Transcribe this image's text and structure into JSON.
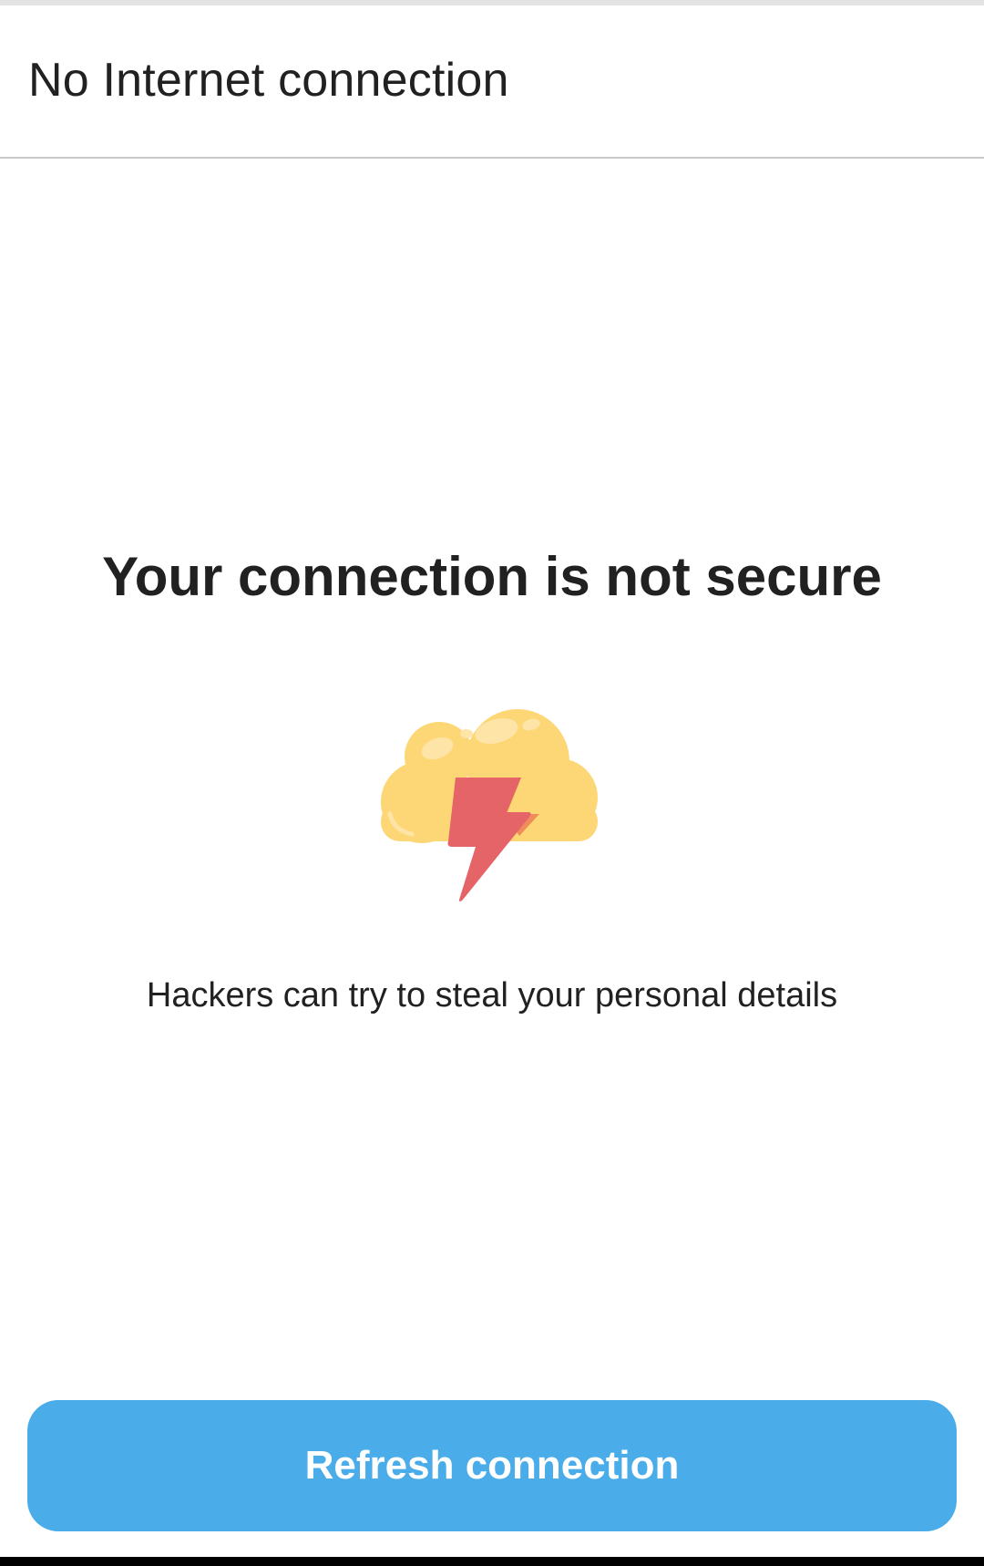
{
  "header": {
    "title": "No Internet connection"
  },
  "main": {
    "headline": "Your connection is not secure",
    "illustration_icon": "cloud-lightning-icon",
    "description": "Hackers can try to steal your personal details"
  },
  "actions": {
    "refresh_label": "Refresh connection"
  },
  "colors": {
    "button": "#4aace8",
    "cloud": "#fdd775",
    "bolt": "#e56468",
    "text": "#212121"
  }
}
